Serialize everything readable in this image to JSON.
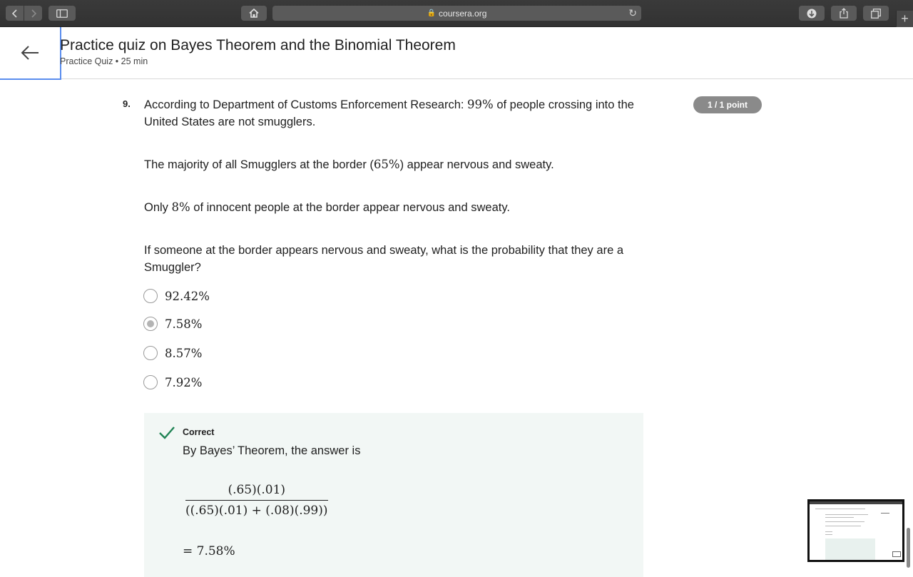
{
  "browser": {
    "url": "coursera.org"
  },
  "header": {
    "title": "Practice quiz on Bayes Theorem and the Binomial Theorem",
    "subtitle": "Practice Quiz • 25 min"
  },
  "question": {
    "number": "9.",
    "points": "1 / 1 point",
    "p1_a": "According to Department of Customs Enforcement Research: ",
    "p1_math": "99%",
    "p1_b": " of people crossing into the United States are not smugglers.",
    "p2_a": "The majority of all Smugglers at the border (",
    "p2_math": "65%",
    "p2_b": ") appear nervous and sweaty.",
    "p3_a": "Only ",
    "p3_math": "8%",
    "p3_b": " of innocent people at the border appear nervous and sweaty.",
    "p4": "If someone at the border appears nervous and sweaty, what is the probability that they are a Smuggler?",
    "options": [
      {
        "label": "92.42%",
        "selected": false
      },
      {
        "label": "7.58%",
        "selected": true
      },
      {
        "label": "8.57%",
        "selected": false
      },
      {
        "label": "7.92%",
        "selected": false
      }
    ]
  },
  "feedback": {
    "status": "Correct",
    "text": "By Bayes’ Theorem, the answer is",
    "numerator": "(.65)(.01)",
    "denominator": "((.65)(.01) + (.08)(.99))",
    "result": "= 7.58%"
  }
}
